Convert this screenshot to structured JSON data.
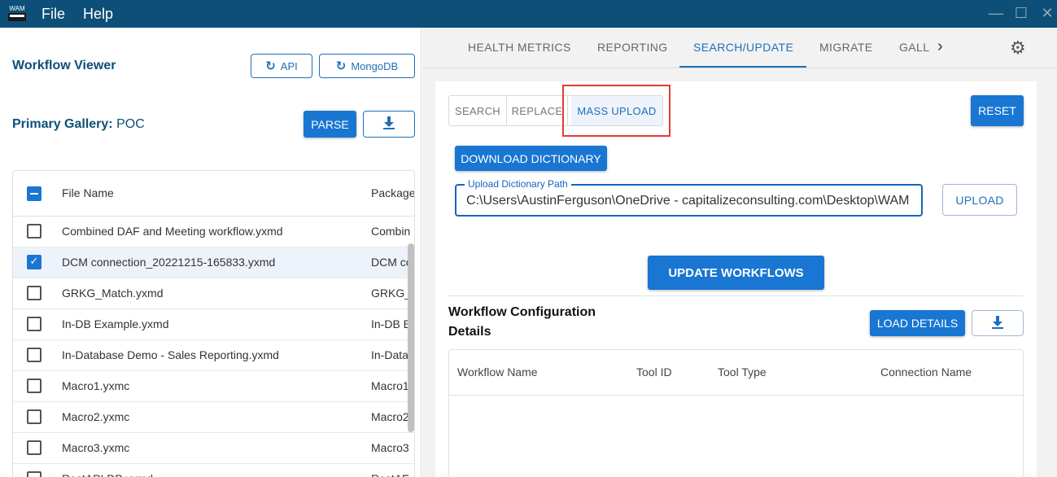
{
  "titlebar": {
    "logo_text": "WAM",
    "menu": [
      "File",
      "Help"
    ],
    "window_controls": [
      "minimize-icon",
      "maximize-icon",
      "close-icon"
    ]
  },
  "left": {
    "title": "Workflow Viewer",
    "api_button": "API",
    "mongodb_button": "MongoDB",
    "gallery_label": "Primary Gallery:",
    "gallery_value": "POC",
    "parse_button": "PARSE",
    "table": {
      "columns": [
        "File Name",
        "Package"
      ],
      "rows": [
        {
          "name": "Combined DAF and Meeting workflow.yxmd",
          "package": "Combin",
          "checked": false
        },
        {
          "name": "DCM connection_20221215-165833.yxmd",
          "package": "DCM co",
          "checked": true
        },
        {
          "name": "GRKG_Match.yxmd",
          "package": "GRKG_",
          "checked": false
        },
        {
          "name": "In-DB Example.yxmd",
          "package": "In-DB E",
          "checked": false
        },
        {
          "name": "In-Database Demo - Sales Reporting.yxmd",
          "package": "In-Data",
          "checked": false
        },
        {
          "name": "Macro1.yxmc",
          "package": "Macro1",
          "checked": false
        },
        {
          "name": "Macro2.yxmc",
          "package": "Macro2",
          "checked": false
        },
        {
          "name": "Macro3.yxmc",
          "package": "Macro3",
          "checked": false
        },
        {
          "name": "RestAPI DB.yxmd",
          "package": "RestAF",
          "checked": false
        }
      ]
    }
  },
  "right": {
    "tabs": [
      "HEALTH METRICS",
      "REPORTING",
      "SEARCH/UPDATE",
      "MIGRATE",
      "GALL"
    ],
    "active_tab": "SEARCH/UPDATE",
    "subtabs": [
      "SEARCH",
      "REPLACE",
      "MASS UPLOAD"
    ],
    "active_subtab": "MASS UPLOAD",
    "reset_button": "RESET",
    "download_dictionary_button": "DOWNLOAD DICTIONARY",
    "upload_path": {
      "label": "Upload Dictionary Path",
      "value": "C:\\Users\\AustinFerguson\\OneDrive - capitalizeconsulting.com\\Desktop\\WAM"
    },
    "upload_button": "UPLOAD",
    "update_workflows_button": "UPDATE WORKFLOWS",
    "section_title_line1": "Workflow Configuration",
    "section_title_line2": "Details",
    "load_details_button": "LOAD DETAILS",
    "details_columns": [
      "Workflow Name",
      "Tool ID",
      "Tool Type",
      "Connection Name"
    ]
  },
  "colors": {
    "titlebar": "#0d4f78",
    "primary": "#1976d2",
    "highlight": "#e53935"
  }
}
